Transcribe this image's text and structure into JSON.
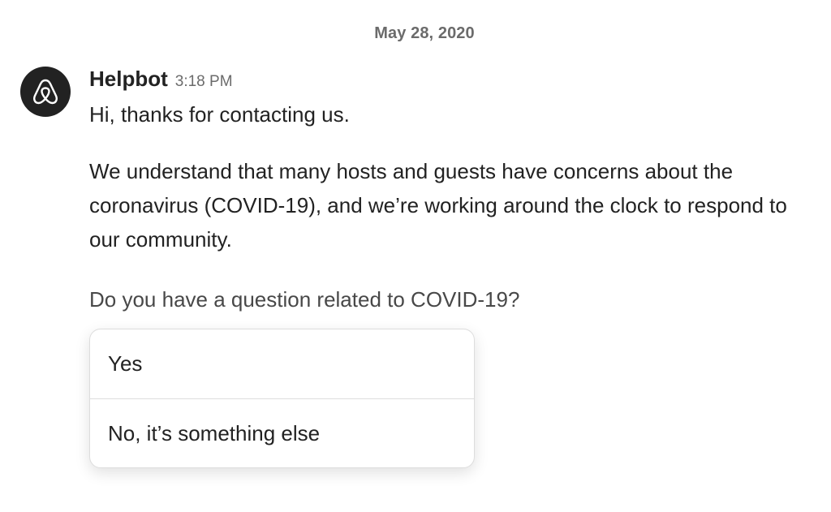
{
  "date_divider": "May 28, 2020",
  "message": {
    "sender": "Helpbot",
    "time": "3:18 PM",
    "avatar_icon": "airbnb-logo-icon",
    "greeting": "Hi, thanks for contacting us.",
    "paragraph": "We understand that many hosts and guests have concerns about the coronavirus (COVID-19), and we’re working around the clock to respond to our community.",
    "question": "Do you have a question related to COVID-19?"
  },
  "options": [
    {
      "label": "Yes"
    },
    {
      "label": "No, it’s something else"
    }
  ],
  "colors": {
    "text_primary": "#222222",
    "text_secondary": "#6b6b6b",
    "avatar_bg": "#222222",
    "border": "#dddddd"
  }
}
